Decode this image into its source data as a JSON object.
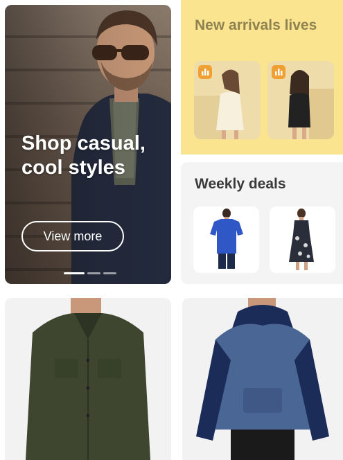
{
  "hero": {
    "title": "Shop casual, cool styles",
    "button_label": "View more",
    "carousel": {
      "count": 3,
      "active_index": 0
    }
  },
  "arrivals": {
    "title": "New arrivals lives",
    "thumbnails": [
      {
        "badge_icon": "live-chart-icon"
      },
      {
        "badge_icon": "live-chart-icon"
      }
    ]
  },
  "deals": {
    "title": "Weekly deals",
    "items": [
      {
        "image": "blue-tshirt"
      },
      {
        "image": "floral-dress"
      }
    ]
  },
  "products": [
    {
      "image": "olive-shirt-jacket"
    },
    {
      "image": "navy-raglan-hoodie"
    }
  ],
  "colors": {
    "arrivals_bg": "#fbe490",
    "arrivals_text": "#8e8350",
    "badge": "#f0a032",
    "deals_bg": "#f4f4f4",
    "product_bg": "#f2f2f2"
  }
}
